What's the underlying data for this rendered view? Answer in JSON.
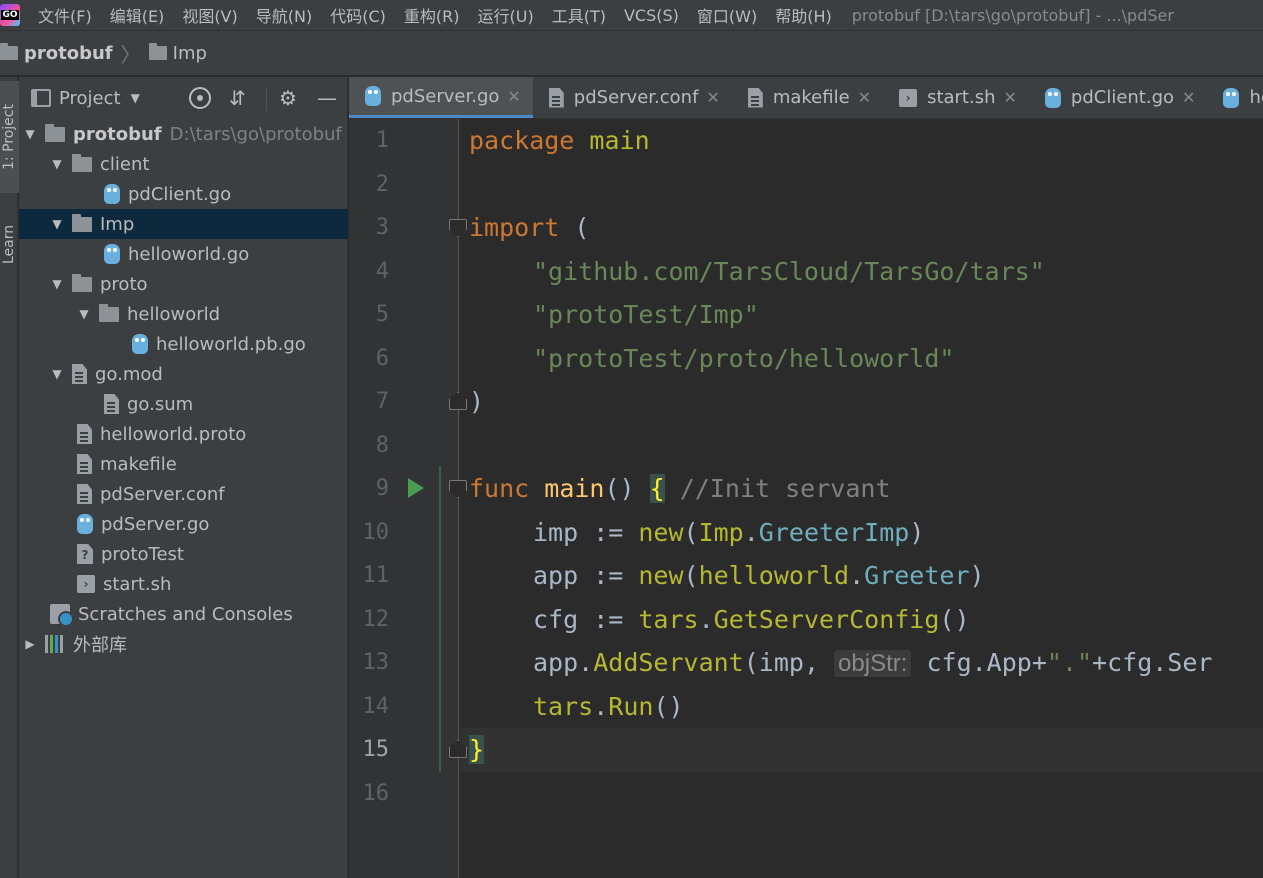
{
  "menubar": {
    "logo": "GO",
    "items": [
      "文件(F)",
      "编辑(E)",
      "视图(V)",
      "导航(N)",
      "代码(C)",
      "重构(R)",
      "运行(U)",
      "工具(T)",
      "VCS(S)",
      "窗口(W)",
      "帮助(H)"
    ],
    "window_title": "protobuf [D:\\tars\\go\\protobuf] - ...\\pdSer"
  },
  "breadcrumb": {
    "root": "protobuf",
    "child": "Imp"
  },
  "left_stripe": {
    "project_tab": "1: Project",
    "learn_tab": "Learn"
  },
  "project_panel": {
    "header_label": "Project",
    "icons": [
      "project-view-icon",
      "dropdown-arrow-icon",
      "locate-icon",
      "collapse-all-icon",
      "gear-icon",
      "hide-icon"
    ],
    "tree": [
      {
        "label": "protobuf",
        "path": "D:\\tars\\go\\protobuf",
        "icon": "folder-icon",
        "expanded": true
      },
      {
        "label": "client",
        "icon": "folder-icon",
        "expanded": true
      },
      {
        "label": "pdClient.go",
        "icon": "go-file-icon"
      },
      {
        "label": "Imp",
        "icon": "folder-icon",
        "expanded": true,
        "selected": true
      },
      {
        "label": "helloworld.go",
        "icon": "go-file-icon"
      },
      {
        "label": "proto",
        "icon": "folder-icon",
        "expanded": true
      },
      {
        "label": "helloworld",
        "icon": "folder-icon",
        "expanded": true
      },
      {
        "label": "helloworld.pb.go",
        "icon": "go-file-icon"
      },
      {
        "label": "go.mod",
        "icon": "text-file-icon",
        "expanded": true
      },
      {
        "label": "go.sum",
        "icon": "text-file-icon"
      },
      {
        "label": "helloworld.proto",
        "icon": "text-file-icon"
      },
      {
        "label": "makefile",
        "icon": "text-file-icon"
      },
      {
        "label": "pdServer.conf",
        "icon": "text-file-icon"
      },
      {
        "label": "pdServer.go",
        "icon": "go-file-icon"
      },
      {
        "label": "protoTest",
        "icon": "unknown-file-icon"
      },
      {
        "label": "start.sh",
        "icon": "shell-file-icon"
      },
      {
        "label": "Scratches and Consoles",
        "icon": "scratches-icon"
      },
      {
        "label": "外部库",
        "icon": "library-icon",
        "expanded": false
      }
    ]
  },
  "tabs": [
    {
      "label": "pdServer.go",
      "icon": "go-file-icon",
      "active": true
    },
    {
      "label": "pdServer.conf",
      "icon": "text-file-icon"
    },
    {
      "label": "makefile",
      "icon": "text-file-icon"
    },
    {
      "label": "start.sh",
      "icon": "shell-file-icon"
    },
    {
      "label": "pdClient.go",
      "icon": "go-file-icon"
    },
    {
      "label": "hello",
      "icon": "go-file-icon"
    }
  ],
  "editor": {
    "current_line": 15,
    "line_numbers": [
      "1",
      "2",
      "3",
      "4",
      "5",
      "6",
      "7",
      "8",
      "9",
      "10",
      "11",
      "12",
      "13",
      "14",
      "15",
      "16"
    ],
    "lines": {
      "l1_kw": "package",
      "l1_name": " main",
      "l3_kw": "import",
      "l3_paren": " (",
      "l4": "\"github.com/TarsCloud/TarsGo/tars\"",
      "l5": "\"protoTest/Imp\"",
      "l6": "\"protoTest/proto/helloworld\"",
      "l7": ")",
      "l9_kw": "func",
      "l9_fn": " main",
      "l9_parens": "() ",
      "l9_brace": "{",
      "l9_comment": " //Init servant",
      "l10_a": "imp := ",
      "l10_new": "new",
      "l10_p1": "(",
      "l10_pkg": "Imp",
      "l10_dot": ".",
      "l10_type": "GreeterImp",
      "l10_p2": ")",
      "l11_a": "app := ",
      "l11_new": "new",
      "l11_p1": "(",
      "l11_pkg": "helloworld",
      "l11_dot": ".",
      "l11_type": "Greeter",
      "l11_p2": ")",
      "l12_a": "cfg := ",
      "l12_pkg": "tars",
      "l12_dot": ".",
      "l12_fn": "GetServerConfig",
      "l12_p": "()",
      "l13_a": "app",
      "l13_dot": ".",
      "l13_fn": "AddServant",
      "l13_b": "(imp, ",
      "l13_hint": "objStr:",
      "l13_c": " cfg.App+",
      "l13_str": "\".\"",
      "l13_d": "+cfg.Ser",
      "l14_pkg": "tars",
      "l14_dot": ".",
      "l14_fn": "Run",
      "l14_p": "()",
      "l15": "}"
    }
  }
}
